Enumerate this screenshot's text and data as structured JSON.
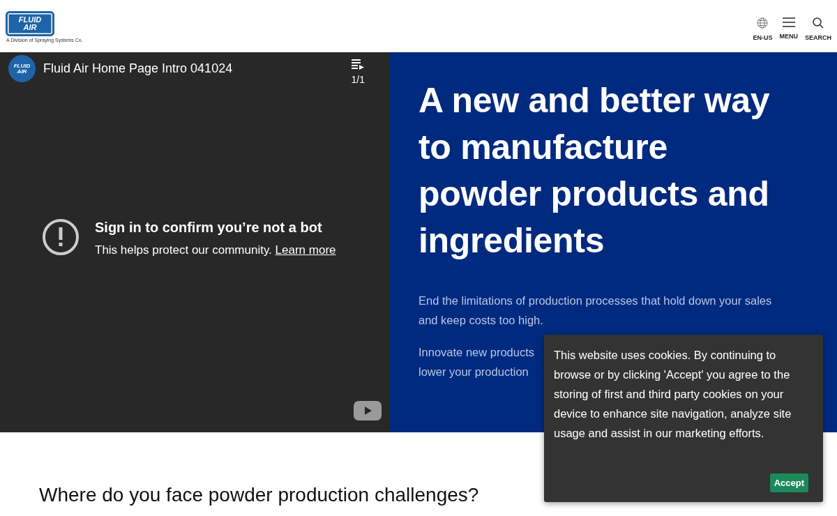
{
  "header": {
    "logo": {
      "line_1": "FLUID",
      "line_2": "AIR",
      "tagline": "A Division of Spraying Systems Co."
    },
    "nav": [
      {
        "kind": "globe",
        "label": "EN-US"
      },
      {
        "kind": "menu",
        "label": "MENU"
      },
      {
        "kind": "search",
        "label": "SEARCH"
      }
    ]
  },
  "video": {
    "channel_logo": {
      "line_1": "FLUID",
      "line_2": "AIR"
    },
    "title": "Fluid Air Home Page Intro 041024",
    "playlist_count": "1/1",
    "message_title": "Sign in to confirm you’re not a bot",
    "message_text": "This helps protect our community.",
    "message_link": "Learn more"
  },
  "hero": {
    "heading": "A new and better way to manufacture powder products and ingredients",
    "paragraph_1": "End the limitations of production processes that hold down your sales and keep costs too high.",
    "paragraph_2_lines": [
      "Innovate new products",
      "lower your production"
    ]
  },
  "section_heading": "Where do you face powder production challenges?",
  "cookie_notice": {
    "text": "This website uses cookies. By continuing to browse or by clicking 'Accept' you agree to the storing of first and third party cookies on your device to enhance site navigation, analyze site usage and assist in our marketing efforts.",
    "button": "Accept"
  }
}
